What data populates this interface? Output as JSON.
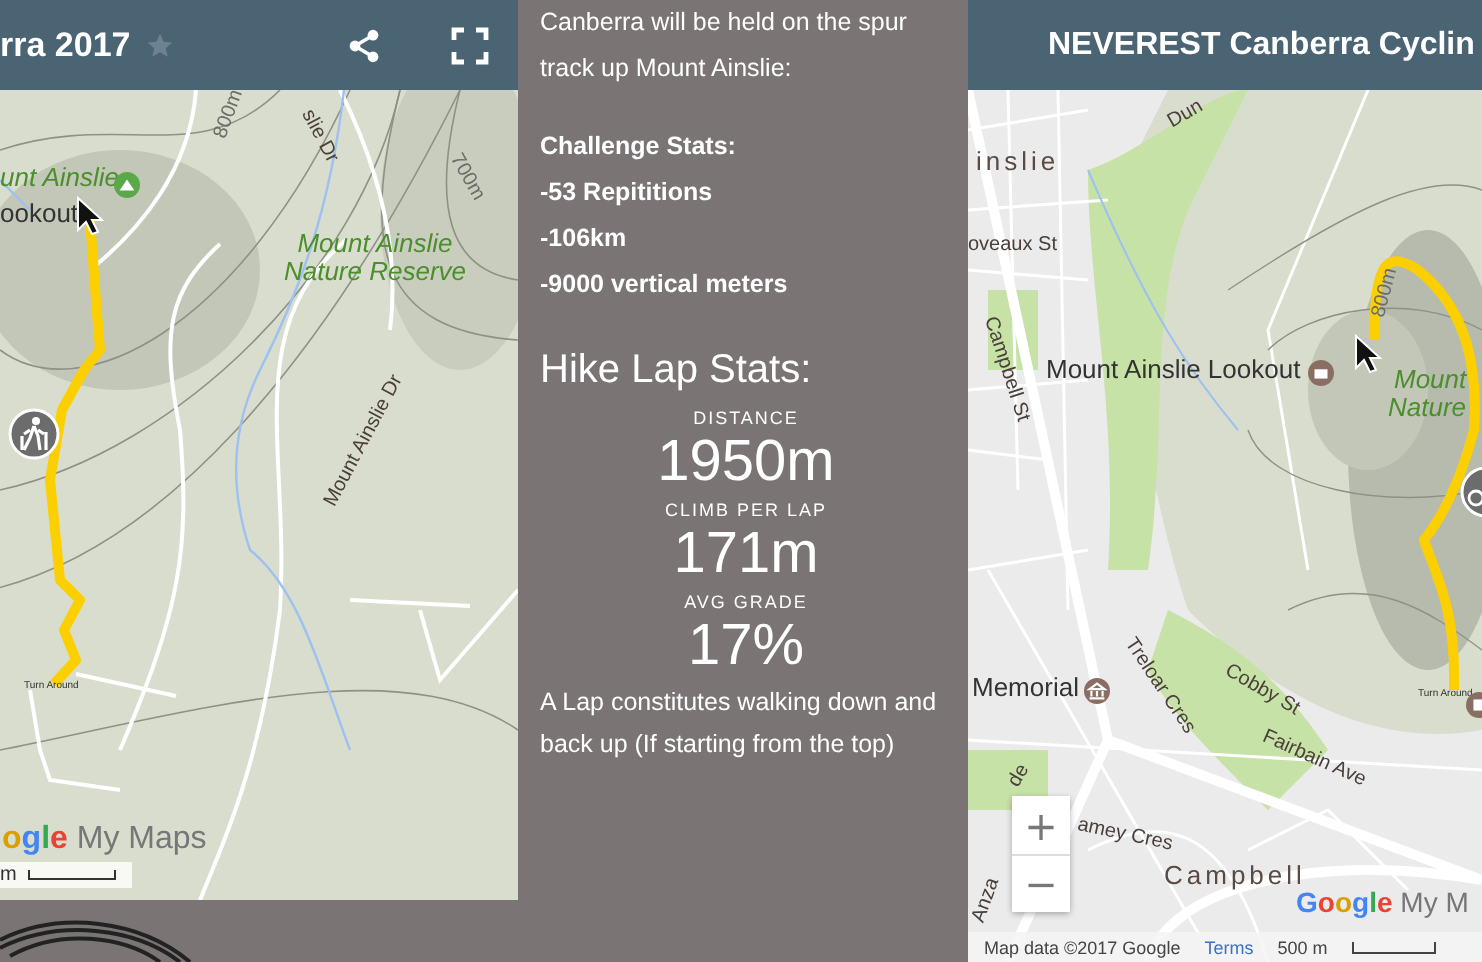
{
  "left_map": {
    "title": "rra 2017",
    "starred": false,
    "labels": [
      {
        "text": "unt Ainslie",
        "kind": "park"
      },
      {
        "text": "ookout",
        "kind": "place"
      },
      {
        "text": "800m",
        "kind": "contour"
      },
      {
        "text": "slie Dr",
        "kind": "road"
      },
      {
        "text": "700m",
        "kind": "contour"
      },
      {
        "text": "Mount Ainslie Nature Reserve",
        "kind": "park"
      },
      {
        "text": "Mount Ainslie Dr",
        "kind": "road"
      },
      {
        "text": "Turn Around",
        "kind": "tiny"
      }
    ],
    "logo": "ogle",
    "logo_suffix": "My Maps",
    "scale": "m"
  },
  "info": {
    "intro": "Canberra will be held on the spur track up Mount Ainslie:",
    "stats_heading": "Challenge Stats:",
    "stats": [
      "-53 Repititions",
      "-106km",
      "-9000 vertical meters"
    ],
    "lap_heading": "Hike Lap Stats:",
    "lap_stats": [
      {
        "label": "DISTANCE",
        "value": "1950m"
      },
      {
        "label": "CLIMB PER LAP",
        "value": "171m"
      },
      {
        "label": "AVG GRADE",
        "value": "17%"
      }
    ],
    "note": "A Lap constitutes walking down and back up (If starting from the top)"
  },
  "right_map": {
    "title": "NEVEREST Canberra Cyclin",
    "labels": [
      {
        "text": "Dun",
        "kind": "road"
      },
      {
        "text": "inslie",
        "kind": "suburb"
      },
      {
        "text": "oveaux St",
        "kind": "road"
      },
      {
        "text": "Campbell St",
        "kind": "road"
      },
      {
        "text": "Mount Ainslie Lookout",
        "kind": "place"
      },
      {
        "text": "800m",
        "kind": "contour"
      },
      {
        "text": "Mount",
        "kind": "park"
      },
      {
        "text": "Nature",
        "kind": "park"
      },
      {
        "text": "Memorial",
        "kind": "place"
      },
      {
        "text": "Treloar Cres",
        "kind": "road"
      },
      {
        "text": "Cobby St",
        "kind": "road"
      },
      {
        "text": "Fairbain Ave",
        "kind": "road"
      },
      {
        "text": "de",
        "kind": "road"
      },
      {
        "text": "amey Cres",
        "kind": "road"
      },
      {
        "text": "Anza",
        "kind": "road"
      },
      {
        "text": "Campbell",
        "kind": "suburb"
      },
      {
        "text": "Turn Around",
        "kind": "tiny"
      }
    ],
    "zoom_in": "+",
    "zoom_out": "−",
    "logo": "Google",
    "logo_suffix": "My M",
    "attribution": "Map data ©2017 Google",
    "terms": "Terms",
    "scale": "500 m"
  }
}
